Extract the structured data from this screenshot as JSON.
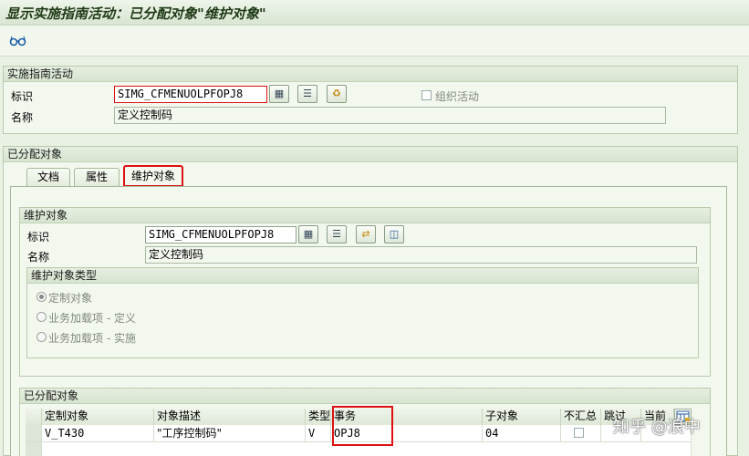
{
  "title": "显示实施指南活动：已分配对象\"维护对象\"",
  "toolbar": {
    "icon": "glasses-icon"
  },
  "impl_group": {
    "header": "实施指南活动",
    "id_label": "标识",
    "id_value": "SIMG_CFMENUOLPFOPJ8",
    "name_label": "名称",
    "name_value": "定义控制码",
    "org_activity_label": "组织活动"
  },
  "assigned_group": {
    "header": "已分配对象",
    "tabs": [
      "文档",
      "属性",
      "维护对象"
    ]
  },
  "maint_group": {
    "header": "维护对象",
    "id_label": "标识",
    "id_value": "SIMG_CFMENUOLPFOPJ8",
    "name_label": "名称",
    "name_value": "定义控制码"
  },
  "type_group": {
    "header": "维护对象类型",
    "options": [
      "定制对象",
      "业务加载项 - 定义",
      "业务加载项 - 实施"
    ],
    "selected": 0
  },
  "assigned_table": {
    "header": "已分配对象",
    "columns": [
      "定制对象",
      "对象描述",
      "类型",
      "事务",
      "子对象",
      "不汇总",
      "跳过",
      "当前"
    ],
    "rows": [
      [
        "V_T430",
        "\"工序控制码\"",
        "V",
        "OPJ8",
        "04",
        "",
        "",
        ""
      ]
    ]
  },
  "watermark": "知乎 @浪中"
}
